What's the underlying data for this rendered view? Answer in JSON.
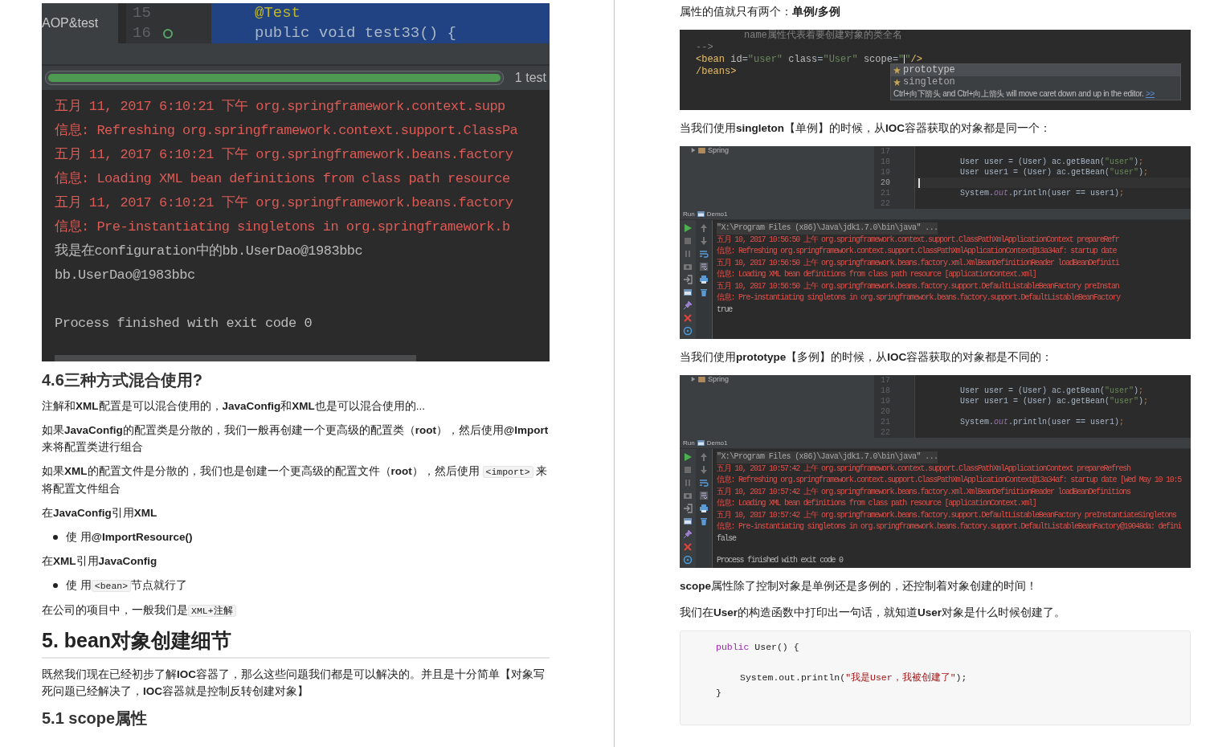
{
  "left_page": {
    "blocks": [
      {
        "kind": "test_shot",
        "project_item": "AOP&test",
        "line_numbers": [
          "15",
          "16"
        ],
        "code_lines": [
          "@Test",
          "public void test33() {"
        ],
        "progress": {
          "level": 1,
          "label": "1 test"
        },
        "console": [
          {
            "kind": "log",
            "text": "五月 11, 2017 6:10:21 下午 org.springframework.context.supp"
          },
          {
            "kind": "log",
            "text": "信息: Refreshing org.springframework.context.support.ClassPa"
          },
          {
            "kind": "log",
            "text": "五月 11, 2017 6:10:21 下午 org.springframework.beans.factory"
          },
          {
            "kind": "log",
            "text": "信息: Loading XML bean definitions from class path resource"
          },
          {
            "kind": "log",
            "text": "五月 11, 2017 6:10:21 下午 org.springframework.beans.factory"
          },
          {
            "kind": "log",
            "text": "信息: Pre-instantiating singletons in org.springframework.b"
          },
          {
            "kind": "plain",
            "text": "我是在configuration中的bb.UserDao@1983bbc"
          },
          {
            "kind": "plain",
            "text": "bb.UserDao@1983bbc"
          },
          {
            "kind": "exit",
            "text": "Process finished with exit code 0"
          }
        ]
      },
      {
        "kind": "subtitle",
        "text": "4.6三种方式混合使用?"
      },
      {
        "kind": "paragraph",
        "parts": [
          {
            "kind": "text",
            "text": "注解和**XML**配置是可以混合使用的，**JavaConfig**和**XML**也是可以混合使用的..."
          }
        ]
      },
      {
        "kind": "paragraph",
        "parts": [
          {
            "kind": "text",
            "text": "如果**JavaConfig**的配置类是分散的，我们一般再创建一个更高级的配置类（**root**），然后使用**@Import**来将配置类进行组合"
          }
        ]
      },
      {
        "kind": "paragraph",
        "parts": [
          {
            "kind": "text",
            "text": "如果**XML**的配置文件是分散的，我们也是创建一个更高级的配置文件（**root**），然后使用 "
          },
          {
            "kind": "code",
            "text": "<import>"
          },
          {
            "kind": "text",
            "text": " 来将配置文件组合"
          }
        ]
      },
      {
        "kind": "paragraph",
        "parts": [
          {
            "kind": "text",
            "text": "在**JavaConfig**引用**XML**"
          }
        ]
      },
      {
        "kind": "bullet",
        "parts": [
          {
            "kind": "text",
            "text": "使 用**@ImportResource()**"
          }
        ]
      },
      {
        "kind": "paragraph",
        "parts": [
          {
            "kind": "text",
            "text": "在**XML**引用**JavaConfig**"
          }
        ]
      },
      {
        "kind": "bullet",
        "parts": [
          {
            "kind": "text",
            "text": "使 用"
          },
          {
            "kind": "code",
            "text": "<bean>"
          },
          {
            "kind": "text",
            "text": "节点就行了"
          }
        ]
      },
      {
        "kind": "paragraph",
        "parts": [
          {
            "kind": "text",
            "text": "在公司的项目中，一般我们是"
          },
          {
            "kind": "code",
            "text": "XML+注解"
          }
        ]
      },
      {
        "kind": "title",
        "text": "5. bean对象创建细节"
      },
      {
        "kind": "paragraph",
        "parts": [
          {
            "kind": "text",
            "text": "既然我们现在已经初步了解**IOC**容器了，那么这些问题我们都是可以解决的。并且是十分简单【对象写死问题已经解决了，**IOC**容器就是控制反转创建对象】"
          }
        ]
      },
      {
        "kind": "subtitle",
        "text": "5.1 scope属性"
      }
    ]
  },
  "right_page": {
    "blocks": [
      {
        "kind": "paragraph",
        "parts": [
          {
            "kind": "text",
            "text": "属性的值就只有两个：**单例/多例**"
          }
        ]
      },
      {
        "kind": "editor_shot",
        "lines": [
          {
            "tokens": [
              {
                "kind": "comment",
                "text": "name属性代表着要创建对象的类全名"
              }
            ]
          },
          {
            "tokens": [
              {
                "kind": "comment",
                "text": "-->"
              }
            ]
          },
          {
            "tokens": [
              {
                "kind": "tag",
                "text": "<bean"
              },
              {
                "kind": "attr",
                "text": " id"
              },
              {
                "kind": "plain",
                "text": "="
              },
              {
                "kind": "string",
                "text": "\"user\""
              },
              {
                "kind": "attr",
                "text": " class"
              },
              {
                "kind": "plain",
                "text": "="
              },
              {
                "kind": "string",
                "text": "\"User\""
              },
              {
                "kind": "attr",
                "text": " scope"
              },
              {
                "kind": "plain",
                "text": "="
              },
              {
                "kind": "string",
                "text": "\""
              },
              {
                "kind": "caret"
              },
              {
                "kind": "string",
                "text": "\""
              },
              {
                "kind": "tag",
                "text": "/>"
              }
            ]
          },
          {
            "tokens": [
              {
                "kind": "tag",
                "text": "/beans>"
              }
            ]
          }
        ],
        "popup": {
          "items": [
            {
              "text": "prototype",
              "selected": true
            },
            {
              "text": "singleton",
              "selected": false
            }
          ],
          "hint": "Ctrl+向下箭头 and Ctrl+向上箭头 will move caret down and up in the editor.",
          "link": ">>"
        }
      },
      {
        "kind": "paragraph",
        "parts": [
          {
            "kind": "text",
            "text": "当我们使用**singleton**【单例】的时候，从**IOC**容器获取的对象都是同一个："
          }
        ]
      },
      {
        "kind": "run_shot",
        "tree_item": "Spring",
        "run_label": "Run",
        "config_name": "Demo1",
        "editor_lines": [
          {
            "number": "17",
            "current": false
          },
          {
            "number": "18",
            "current": false,
            "tokens": [
              {
                "kind": "plain",
                "text": "User user = (User) ac.getBean("
              },
              {
                "kind": "string",
                "text": "\"user\""
              },
              {
                "kind": "plain",
                "text": ")"
              },
              {
                "kind": "semicolon",
                "text": ";"
              }
            ]
          },
          {
            "number": "19",
            "current": false,
            "tokens": [
              {
                "kind": "plain",
                "text": "User user1 = (User) ac.getBean("
              },
              {
                "kind": "string",
                "text": "\"user\""
              },
              {
                "kind": "plain",
                "text": ")"
              },
              {
                "kind": "semicolon",
                "text": ";"
              }
            ]
          },
          {
            "number": "20",
            "current": true
          },
          {
            "number": "21",
            "current": false,
            "tokens": [
              {
                "kind": "plain",
                "text": "System."
              },
              {
                "kind": "field",
                "text": "out"
              },
              {
                "kind": "plain",
                "text": ".println(user == user1)"
              },
              {
                "kind": "semicolon",
                "text": ";"
              }
            ]
          },
          {
            "number": "22",
            "current": false
          }
        ],
        "console": [
          {
            "kind": "command",
            "text": "\"X:\\Program Files (x86)\\Java\\jdk1.7.0\\bin\\java\" ..."
          },
          {
            "kind": "log",
            "text": "五月 10, 2017 10:56:50 上午 org.springframework.context.support.ClassPathXmlApplicationContext prepareRefr"
          },
          {
            "kind": "log",
            "text": "信息: Refreshing org.springframework.context.support.ClassPathXmlApplicationContext@13a34af: startup date"
          },
          {
            "kind": "log",
            "text": "五月 10, 2017 10:56:50 上午 org.springframework.beans.factory.xml.XmlBeanDefinitionReader loadBeanDefiniti"
          },
          {
            "kind": "log",
            "text": "信息: Loading XML bean definitions from class path resource [applicationContext.xml]"
          },
          {
            "kind": "log",
            "text": "五月 10, 2017 10:56:50 上午 org.springframework.beans.factory.support.DefaultListableBeanFactory preInstan"
          },
          {
            "kind": "log",
            "text": "信息: Pre-instantiating singletons in org.springframework.beans.factory.support.DefaultListableBeanFactory"
          },
          {
            "kind": "plain",
            "text": "true"
          }
        ]
      },
      {
        "kind": "paragraph",
        "parts": [
          {
            "kind": "text",
            "text": "当我们使用**prototype**【多例】的时候，从**IOC**容器获取的对象都是不同的："
          }
        ]
      },
      {
        "kind": "run_shot",
        "tree_item": "Spring",
        "run_label": "Run",
        "config_name": "Demo1",
        "editor_lines": [
          {
            "number": "17",
            "current": false
          },
          {
            "number": "18",
            "current": false,
            "tokens": [
              {
                "kind": "plain",
                "text": "User user = (User) ac.getBean("
              },
              {
                "kind": "string",
                "text": "\"user\""
              },
              {
                "kind": "plain",
                "text": ")"
              },
              {
                "kind": "semicolon",
                "text": ";"
              }
            ]
          },
          {
            "number": "19",
            "current": false,
            "tokens": [
              {
                "kind": "plain",
                "text": "User user1 = (User) ac.getBean("
              },
              {
                "kind": "string",
                "text": "\"user\""
              },
              {
                "kind": "plain",
                "text": ")"
              },
              {
                "kind": "semicolon",
                "text": ";"
              }
            ]
          },
          {
            "number": "20",
            "current": false
          },
          {
            "number": "21",
            "current": false,
            "tokens": [
              {
                "kind": "plain",
                "text": "System."
              },
              {
                "kind": "field",
                "text": "out"
              },
              {
                "kind": "plain",
                "text": ".println(user == user1)"
              },
              {
                "kind": "semicolon",
                "text": ";"
              }
            ]
          },
          {
            "number": "22",
            "current": false
          }
        ],
        "console": [
          {
            "kind": "command",
            "text": "\"X:\\Program Files (x86)\\Java\\jdk1.7.0\\bin\\java\" ..."
          },
          {
            "kind": "log",
            "text": "五月 10, 2017 10:57:42 上午 org.springframework.context.support.ClassPathXmlApplicationContext prepareRefresh"
          },
          {
            "kind": "log",
            "text": "信息: Refreshing org.springframework.context.support.ClassPathXmlApplicationContext@13a34af: startup date [Wed May 10 10:5"
          },
          {
            "kind": "log",
            "text": "五月 10, 2017 10:57:42 上午 org.springframework.beans.factory.xml.XmlBeanDefinitionReader loadBeanDefinitions"
          },
          {
            "kind": "log",
            "text": "信息: Loading XML bean definitions from class path resource [applicationContext.xml]"
          },
          {
            "kind": "log",
            "text": "五月 10, 2017 10:57:42 上午 org.springframework.beans.factory.support.DefaultListableBeanFactory preInstantiateSingletons"
          },
          {
            "kind": "log",
            "text": "信息: Pre-instantiating singletons in org.springframework.beans.factory.support.DefaultListableBeanFactory@19048da: defini"
          },
          {
            "kind": "plain",
            "text": "false"
          },
          {
            "kind": "exit",
            "text": "Process finished with exit code 0"
          }
        ]
      },
      {
        "kind": "paragraph",
        "parts": [
          {
            "kind": "text",
            "text": "**scope**属性除了控制对象是单例还是多例的，还控制着对象创建的时间！"
          }
        ]
      },
      {
        "kind": "paragraph",
        "parts": [
          {
            "kind": "text",
            "text": "我们在**User**的构造函数中打印出一句话，就知道**User**对象是什么时候创建了。"
          }
        ]
      },
      {
        "kind": "code_block",
        "lines": [
          {
            "tokens": [
              {
                "kind": "keyword",
                "text": "public"
              },
              {
                "kind": "plain",
                "text": " User() {"
              }
            ],
            "children": [
              {
                "tokens": [
                  {
                    "kind": "plain",
                    "text": "System.out.println("
                  },
                  {
                    "kind": "string",
                    "text": "\"我是User，我被创建了\""
                  },
                  {
                    "kind": "plain",
                    "text": ");"
                  }
                ]
              }
            ]
          },
          {
            "tokens": [
              {
                "kind": "plain",
                "text": "}"
              }
            ]
          }
        ]
      }
    ]
  }
}
